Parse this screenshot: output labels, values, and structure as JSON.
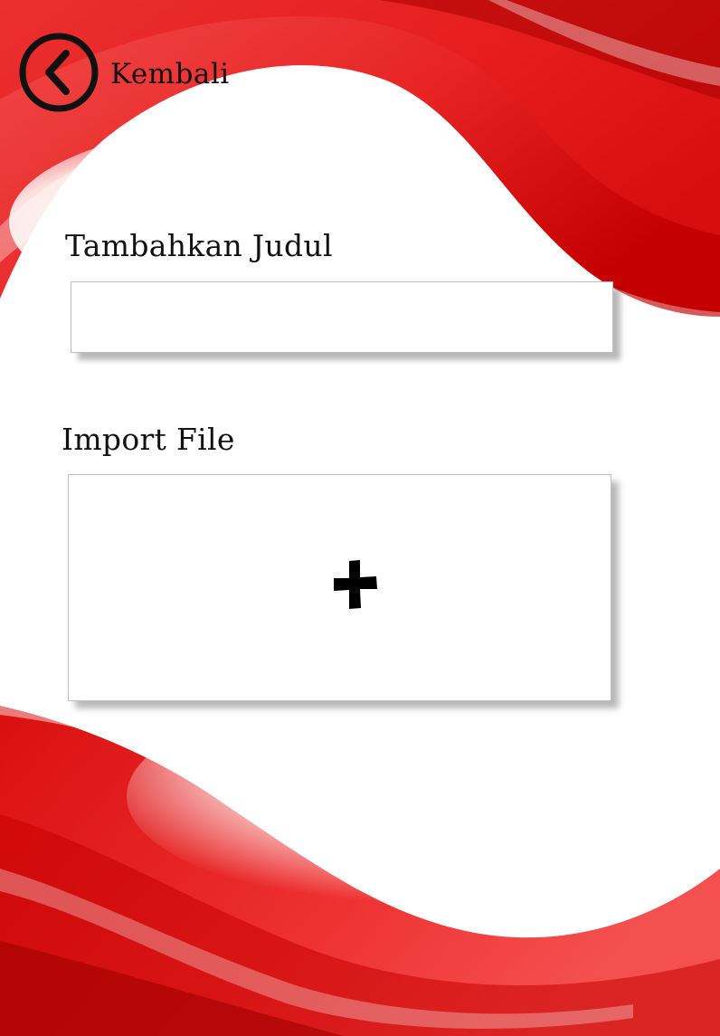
{
  "back": {
    "label": "Kembali",
    "icon": "chevron-left-circle-icon"
  },
  "title_section": {
    "heading": "Tambahkan Judul",
    "input_value": "",
    "placeholder": ""
  },
  "import_section": {
    "heading": "Import File",
    "icon": "plus-icon"
  },
  "colors": {
    "accent_red": "#e02020",
    "dark_red": "#b80000",
    "text": "#111111",
    "panel": "#ffffff"
  }
}
